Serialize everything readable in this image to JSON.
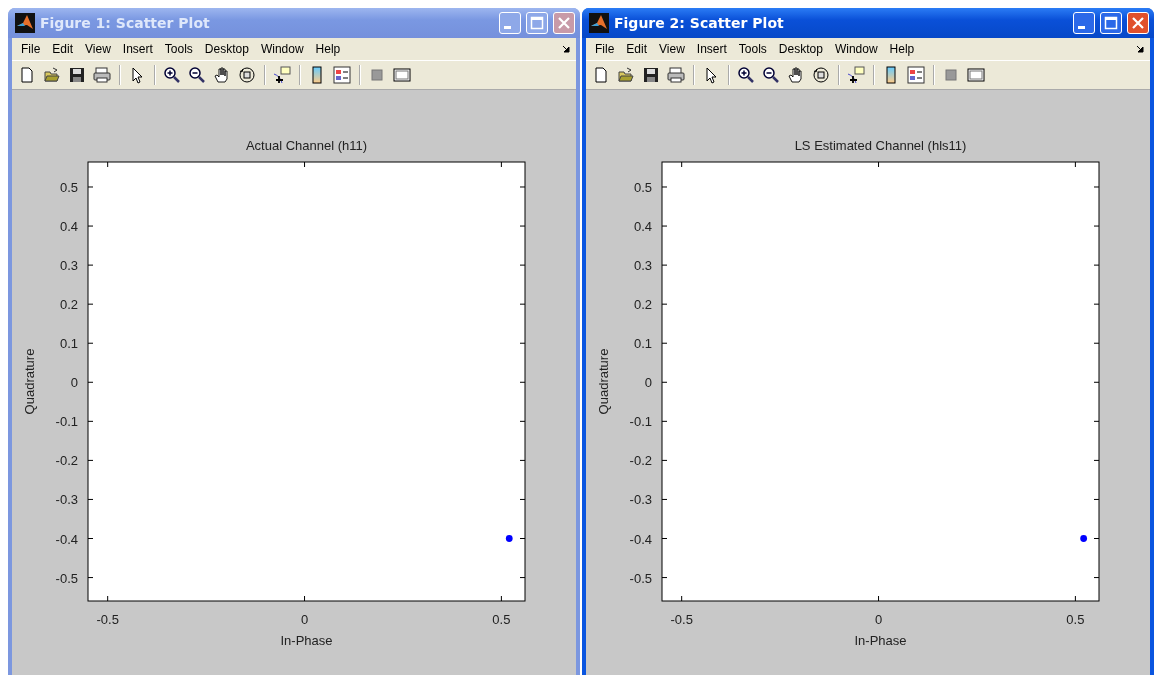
{
  "windows": [
    {
      "title": "Figure 1: Scatter Plot",
      "active": false,
      "menus": [
        "File",
        "Edit",
        "View",
        "Insert",
        "Tools",
        "Desktop",
        "Window",
        "Help"
      ],
      "chart_data": {
        "type": "scatter",
        "title": "Actual Channel (h11)",
        "xlabel": "In-Phase",
        "ylabel": "Quadrature",
        "xlim": [
          -0.55,
          0.56
        ],
        "ylim": [
          -0.56,
          0.564
        ],
        "xticks": [
          -0.5,
          0,
          0.5
        ],
        "yticks": [
          0.5,
          0.4,
          0.3,
          0.2,
          0.1,
          0,
          -0.1,
          -0.2,
          -0.3,
          -0.4,
          -0.5
        ],
        "series": [
          {
            "color": "#0000ff",
            "x": [
              0.52
            ],
            "values": [
              -0.4
            ]
          }
        ]
      }
    },
    {
      "title": "Figure 2: Scatter Plot",
      "active": true,
      "menus": [
        "File",
        "Edit",
        "View",
        "Insert",
        "Tools",
        "Desktop",
        "Window",
        "Help"
      ],
      "chart_data": {
        "type": "scatter",
        "title": "LS Estimated Channel (hls11)",
        "xlabel": "In-Phase",
        "ylabel": "Quadrature",
        "xlim": [
          -0.55,
          0.56
        ],
        "ylim": [
          -0.56,
          0.564
        ],
        "xticks": [
          -0.5,
          0,
          0.5
        ],
        "yticks": [
          0.5,
          0.4,
          0.3,
          0.2,
          0.1,
          0,
          -0.1,
          -0.2,
          -0.3,
          -0.4,
          -0.5
        ],
        "series": [
          {
            "color": "#0000ff",
            "x": [
              0.521
            ],
            "values": [
              -0.4
            ]
          }
        ]
      }
    }
  ]
}
